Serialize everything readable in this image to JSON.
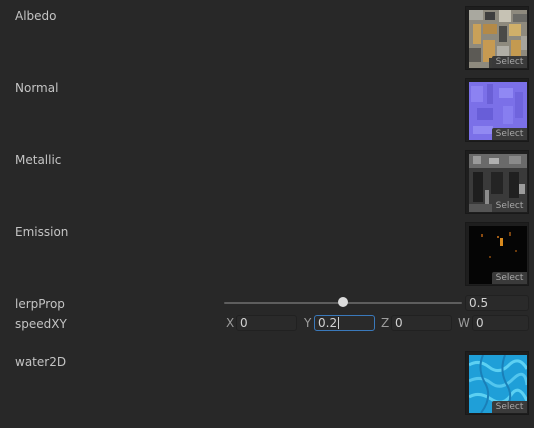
{
  "textures": [
    {
      "label": "Albedo",
      "select_label": "Select",
      "thumbnail": "albedo-texture"
    },
    {
      "label": "Normal",
      "select_label": "Select",
      "thumbnail": "normal-map"
    },
    {
      "label": "Metallic",
      "select_label": "Select",
      "thumbnail": "metallic-map"
    },
    {
      "label": "Emission",
      "select_label": "Select",
      "thumbnail": "emission-map"
    }
  ],
  "lerp": {
    "label": "lerpProp",
    "value": "0.5",
    "fraction": 0.5
  },
  "speed": {
    "label": "speedXY",
    "x_label": "X",
    "x_value": "0",
    "y_label": "Y",
    "y_value": "0.2",
    "z_label": "Z",
    "z_value": "0",
    "w_label": "W",
    "w_value": "0"
  },
  "water": {
    "label": "water2D",
    "select_label": "Select",
    "thumbnail": "water-texture"
  },
  "colors": {
    "background": "#282828",
    "focus_border": "#3a79bb",
    "text": "#c4c4c4"
  }
}
